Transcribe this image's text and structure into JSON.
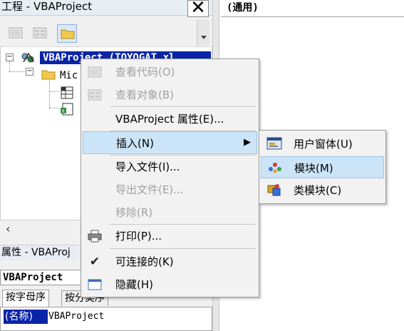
{
  "project_pane": {
    "title": "工程 - VBAProject",
    "close_glyph": "✕",
    "tree": {
      "root_label": "VBAProject (TOYOGAT.xl",
      "child_label": "Mic"
    }
  },
  "properties_pane": {
    "title": "属性 - VBAProj",
    "object_combo": "VBAProject",
    "tabs": [
      "按字母序",
      "按分类序"
    ],
    "rows": [
      {
        "name": "(名称)",
        "value": "VBAProject"
      }
    ]
  },
  "code_pane": {
    "object_combo": "(通用)"
  },
  "context_menu": {
    "items": [
      {
        "label": "查看代码(O)",
        "icon": "view-code-icon",
        "disabled": true
      },
      {
        "label": "查看对象(B)",
        "icon": "view-object-icon",
        "disabled": true
      },
      {
        "label": "VBAProject 属性(E)...",
        "icon": "",
        "disabled": false
      },
      {
        "label": "插入(N)",
        "icon": "",
        "disabled": false,
        "submenu": true,
        "highlighted": true
      },
      {
        "label": "导入文件(I)...",
        "icon": "",
        "disabled": false
      },
      {
        "label": "导出文件(E)...",
        "icon": "",
        "disabled": true
      },
      {
        "label": "移除(R)",
        "icon": "",
        "disabled": true
      },
      {
        "label": "打印(P)...",
        "icon": "printer-icon",
        "disabled": false
      },
      {
        "label": "可连接的(K)",
        "icon": "checkmark-icon",
        "disabled": false,
        "checked": true
      },
      {
        "label": "隐藏(H)",
        "icon": "window-icon",
        "disabled": false
      }
    ]
  },
  "insert_submenu": {
    "items": [
      {
        "label": "用户窗体(U)",
        "icon": "userform-icon"
      },
      {
        "label": "模块(M)",
        "icon": "module-icon",
        "highlighted": true
      },
      {
        "label": "类模块(C)",
        "icon": "class-module-icon"
      }
    ]
  },
  "colors": {
    "selection": "#0a24a8",
    "menu_highlight": "#cce4f7"
  }
}
